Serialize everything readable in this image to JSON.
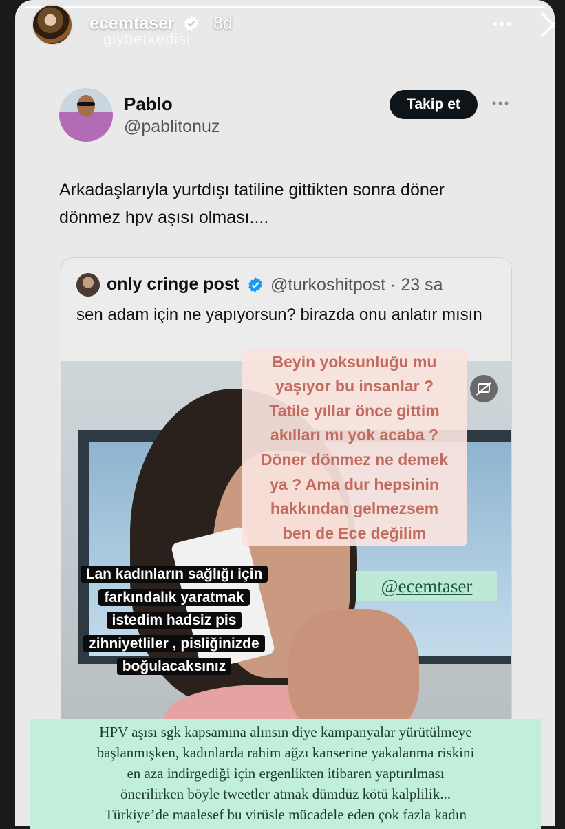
{
  "story": {
    "username": "ecemtaser",
    "age": "8d",
    "watermark": "giybetkedisi",
    "verified_icon": "verified-badge-icon",
    "more_icon": "more-horizontal-icon",
    "close_icon": "close-icon"
  },
  "tweet": {
    "name": "Pablo",
    "handle": "@pablitonuz",
    "follow_label": "Takip et",
    "text": "Arkadaşlarıyla yurtdışı tatiline gittikten sonra döner dönmez hpv aşısı olması....",
    "quoted": {
      "name": "only cringe post",
      "handle": "@turkoshitpost · 23 sa",
      "text": "sen adam için ne yapıyorsun? birazda onu anlatır mısın",
      "caption_toggle_icon": "closed-captions-off-icon"
    }
  },
  "captions": {
    "pink": "Beyin yoksunluğu mu\nyaşıyor bu insanlar ?\nTatile yıllar önce gittim\nakılları mı yok acaba ?\nDöner dönmez ne demek\nya ? Ama dur hepsinin\nhakkından gelmezsem\nben de Ece değilim",
    "black": [
      "Lan kadınların sağlığı için",
      "farkındalık yaratmak",
      "istedim hadsiz pis",
      "zihniyetliler , pisliğinizde",
      "boğulacaksınız"
    ],
    "mention": "@ecemtaser",
    "bottom": "HPV aşısı sgk kapsamına alınsın diye kampanyalar yürütülmeye\nbaşlanmışken, kadınlarda rahim ağzı kanserine yakalanma riskini\nen aza indirgediği için ergenlikten itibaren yaptırılması\nönerilirken böyle tweetler atmak dümdüz kötü kalplilik...\nTürkiye’de maalesef bu virüsle mücadele eden çok fazla kadın"
  },
  "colors": {
    "verified": "#1d9bf0",
    "pink_caption_bg": "#fae4de",
    "pink_caption_text": "#c26b5e",
    "green_note_bg": "#c1efd9"
  }
}
